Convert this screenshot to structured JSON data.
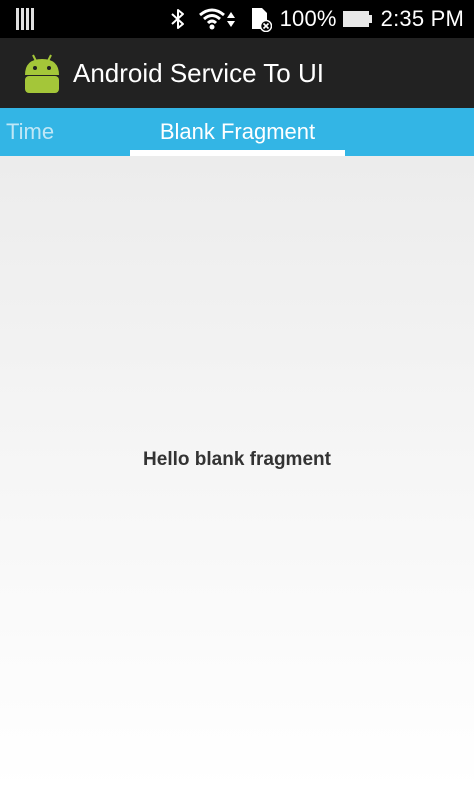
{
  "status_bar": {
    "icons": [
      "sim-card-icon",
      "bluetooth-icon",
      "wifi-icon",
      "data-arrows-icon",
      "sd-card-icon",
      "battery-icon"
    ],
    "battery_percent": "100%",
    "time": "2:35 PM"
  },
  "action_bar": {
    "app_icon": "android-robot-icon",
    "title": "Android Service To UI",
    "background_color": "#222222"
  },
  "tabs": {
    "items": [
      {
        "label": "Time",
        "selected": false
      },
      {
        "label": "Blank Fragment",
        "selected": true
      }
    ],
    "background_color": "#33b5e5",
    "indicator_color": "#ffffff"
  },
  "content": {
    "message": "Hello blank fragment"
  }
}
